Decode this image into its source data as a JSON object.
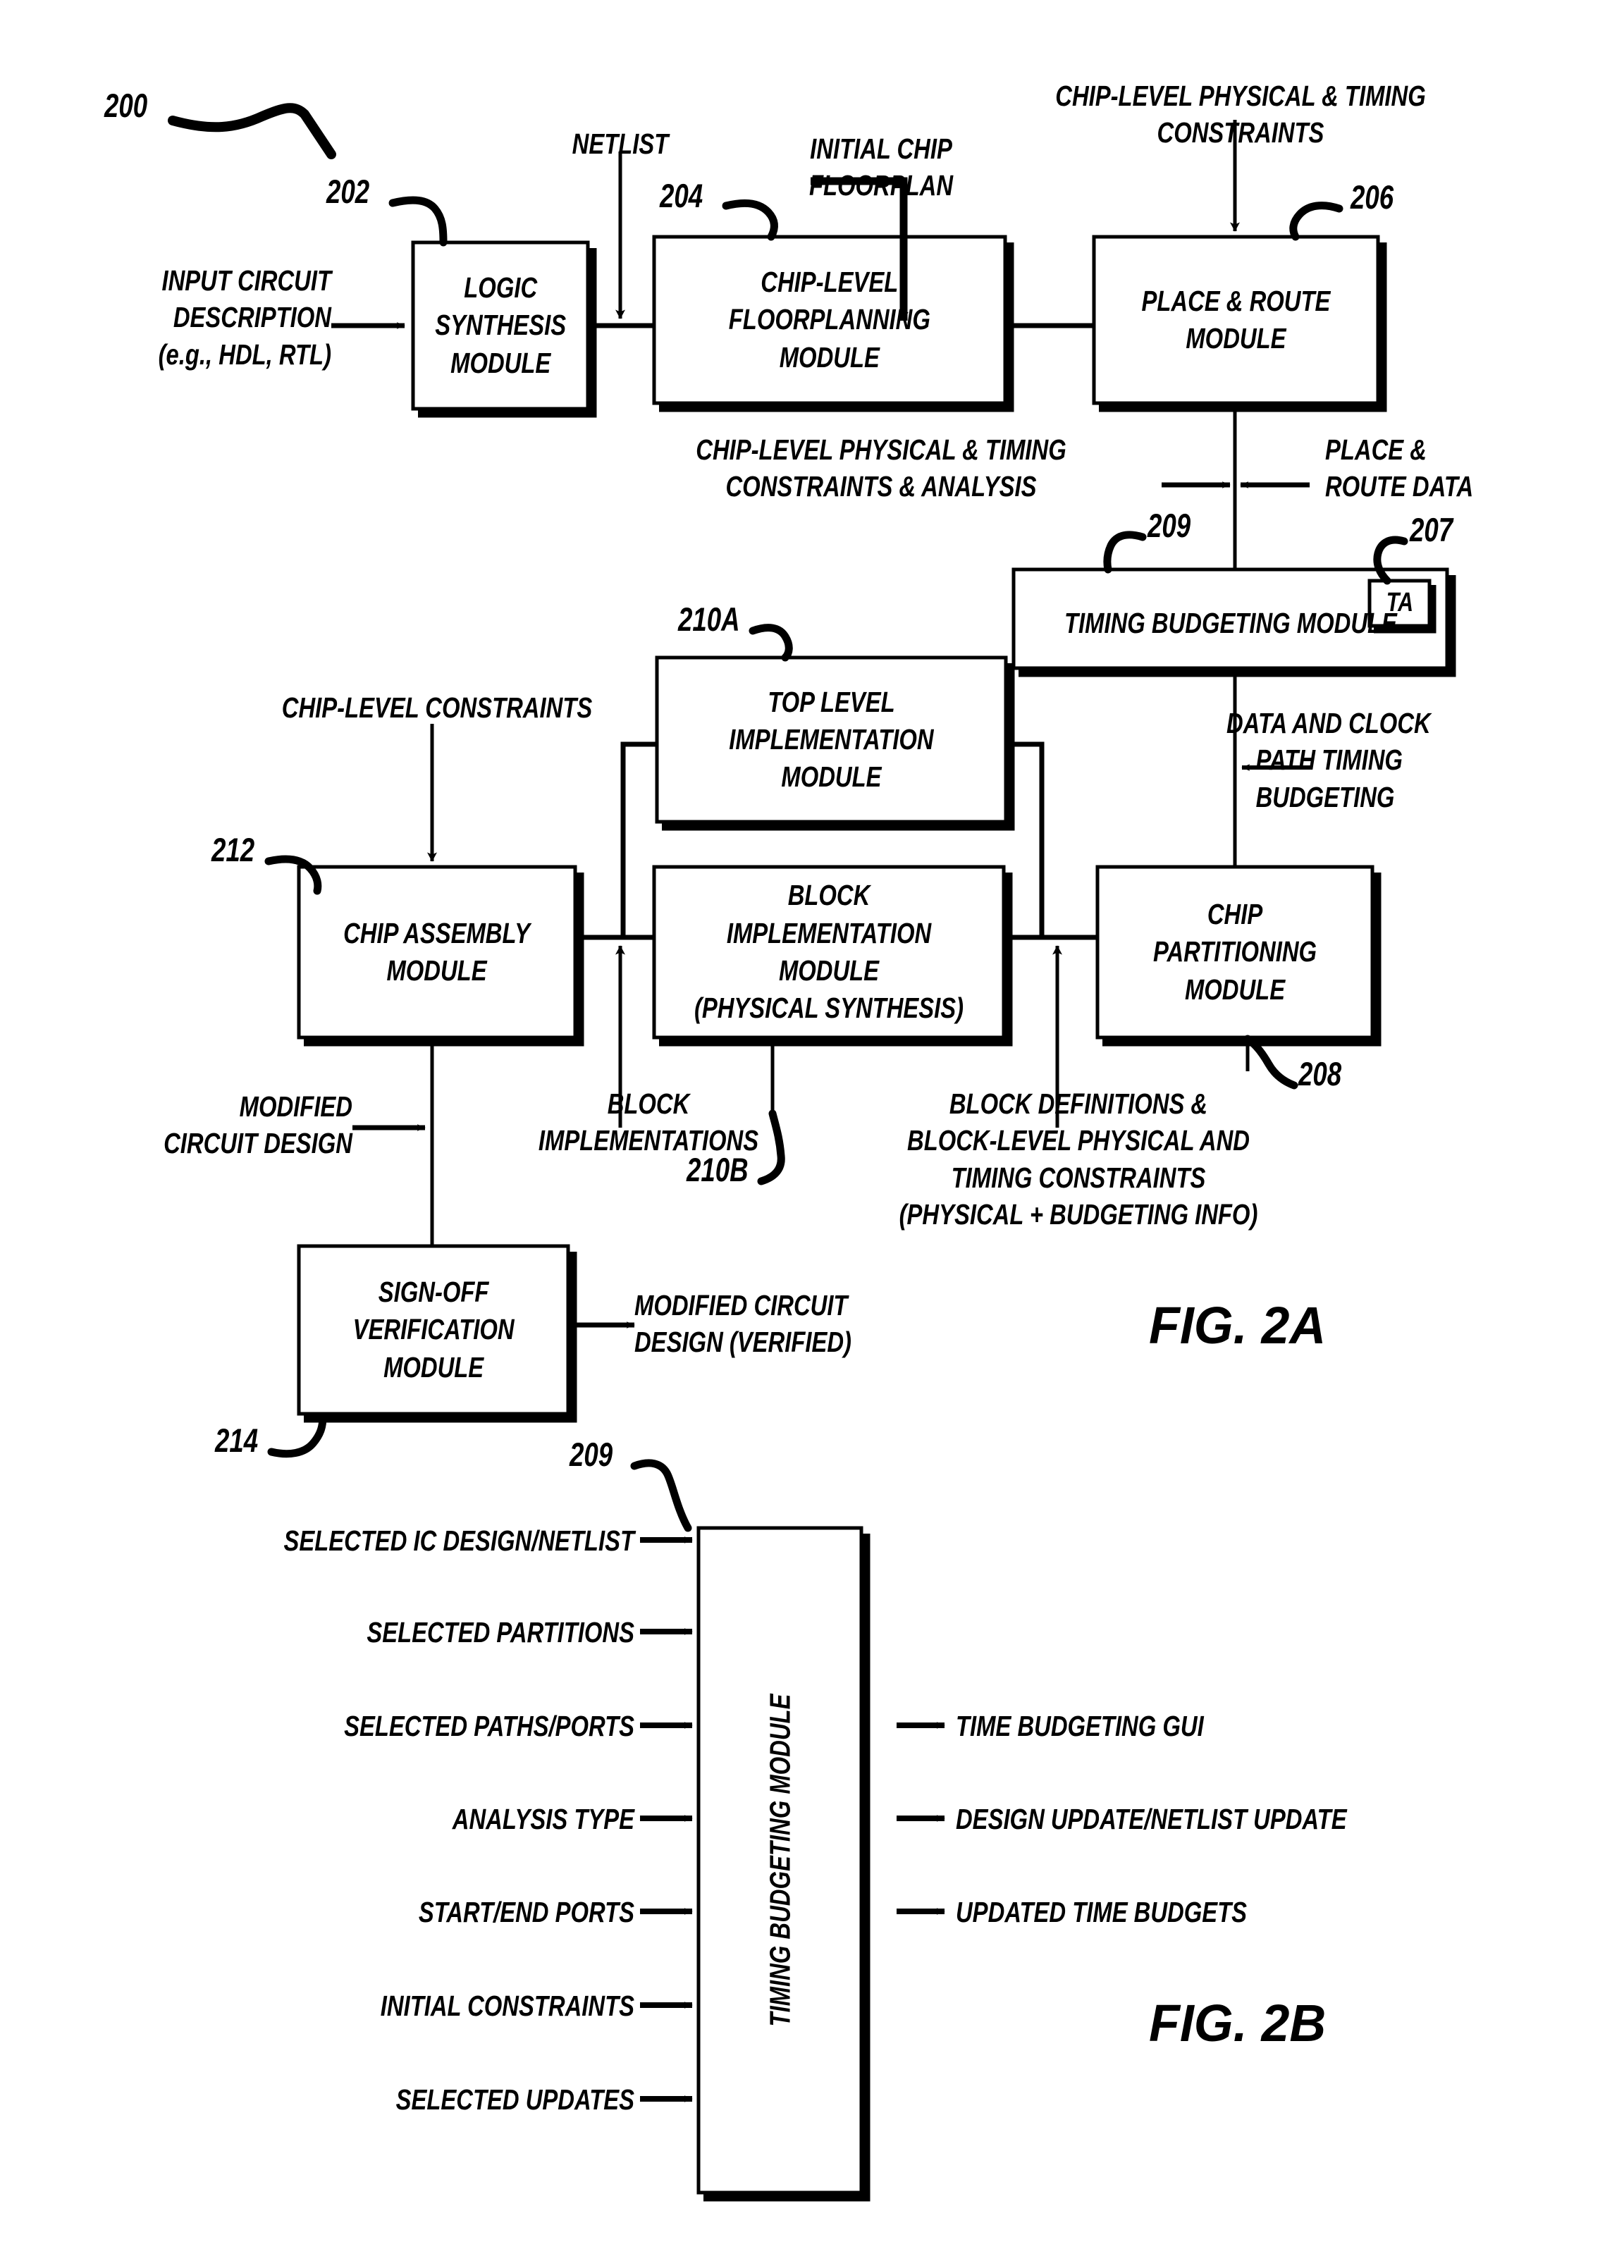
{
  "figures": {
    "fig_2a_label": "FIG. 2A",
    "fig_2b_label": "FIG. 2B"
  },
  "reference_numerals": {
    "flow": "200",
    "logic_synthesis": "202",
    "chip_floorplanning": "204",
    "place_route": "206",
    "timing_analysis_badge": "207",
    "chip_partitioning": "208",
    "timing_budgeting": "209",
    "top_level_impl": "210A",
    "block_impl": "210B",
    "chip_assembly": "212",
    "sign_off": "214",
    "timing_budgeting_2b": "209"
  },
  "fig2a": {
    "boxes": {
      "logic_synthesis": [
        "LOGIC",
        "SYNTHESIS",
        "MODULE"
      ],
      "chip_floorplanning": [
        "CHIP-LEVEL",
        "FLOORPLANNING",
        "MODULE"
      ],
      "place_route": [
        "PLACE & ROUTE",
        "MODULE"
      ],
      "timing_budgeting": [
        "TIMING BUDGETING MODULE"
      ],
      "timing_analysis_badge": "TA",
      "top_level_implementation": [
        "TOP LEVEL",
        "IMPLEMENTATION",
        "MODULE"
      ],
      "block_implementation": [
        "BLOCK IMPLEMENTATION",
        "MODULE",
        "(PHYSICAL SYNTHESIS)"
      ],
      "chip_partitioning": [
        "CHIP",
        "PARTITIONING",
        "MODULE"
      ],
      "chip_assembly": [
        "CHIP ASSEMBLY",
        "MODULE"
      ],
      "sign_off_verification": [
        "SIGN-OFF",
        "VERIFICATION",
        "MODULE"
      ]
    },
    "edge_labels": {
      "input_circuit_description": [
        "INPUT CIRCUIT",
        "DESCRIPTION",
        "(e.g., HDL, RTL)"
      ],
      "netlist": [
        "NETLIST"
      ],
      "initial_chip_floorplan": [
        "INITIAL CHIP",
        "FLOORPLAN"
      ],
      "chip_level_physical_timing_constraints": [
        "CHIP-LEVEL PHYSICAL & TIMING",
        "CONSTRAINTS"
      ],
      "chip_level_constraints_analysis": [
        "CHIP-LEVEL PHYSICAL & TIMING",
        "CONSTRAINTS & ANALYSIS"
      ],
      "place_route_data": [
        "PLACE &",
        "ROUTE DATA"
      ],
      "chip_level_constraints": [
        "CHIP-LEVEL CONSTRAINTS"
      ],
      "data_and_clock_path_timing_budgeting": [
        "DATA AND CLOCK",
        "PATH TIMING",
        "BUDGETING"
      ],
      "block_implementations": [
        "BLOCK",
        "IMPLEMENTATIONS"
      ],
      "block_definitions": [
        "BLOCK DEFINITIONS &",
        "BLOCK-LEVEL PHYSICAL AND",
        "TIMING CONSTRAINTS",
        "(PHYSICAL + BUDGETING INFO)"
      ],
      "modified_circuit_design": [
        "MODIFIED",
        "CIRCUIT DESIGN"
      ],
      "modified_circuit_design_verified": [
        "MODIFIED CIRCUIT",
        "DESIGN (VERIFIED)"
      ]
    }
  },
  "fig2b": {
    "module_label": "TIMING BUDGETING MODULE",
    "inputs": [
      "SELECTED IC DESIGN/NETLIST",
      "SELECTED PARTITIONS",
      "SELECTED PATHS/PORTS",
      "ANALYSIS TYPE",
      "START/END PORTS",
      "INITIAL CONSTRAINTS",
      "SELECTED UPDATES"
    ],
    "outputs": [
      "TIME BUDGETING GUI",
      "DESIGN UPDATE/NETLIST UPDATE",
      "UPDATED TIME BUDGETS"
    ]
  },
  "colors": {
    "ink": "#000000",
    "paper": "#ffffff"
  }
}
